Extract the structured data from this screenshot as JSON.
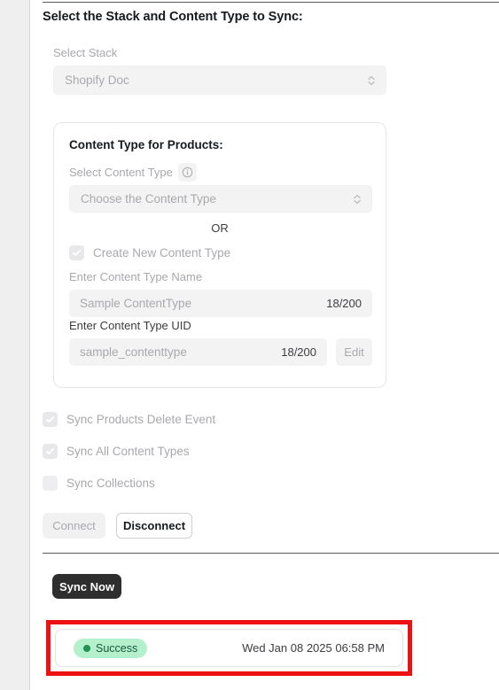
{
  "section": {
    "title": "Select the Stack and Content Type to Sync:"
  },
  "stack": {
    "label": "Select Stack",
    "value": "Shopify Doc",
    "stepper_icon": "up-down-chevron-icon"
  },
  "content_type_card": {
    "title": "Content Type for Products:",
    "select_label": "Select Content Type",
    "info_icon": "info-icon",
    "select_value": "Choose the Content Type",
    "select_stepper_icon": "up-down-chevron-icon",
    "or_text": "OR",
    "create_new": {
      "label": "Create New Content Type",
      "checked": true
    },
    "name_field": {
      "label": "Enter Content Type Name",
      "value": "Sample ContentType",
      "counter": "18/200"
    },
    "uid_field": {
      "label": "Enter Content Type UID",
      "value": "sample_contenttype",
      "counter": "18/200",
      "edit_label": "Edit"
    }
  },
  "options": [
    {
      "label": "Sync Products Delete Event",
      "checked": true
    },
    {
      "label": "Sync All Content Types",
      "checked": true
    },
    {
      "label": "Sync Collections",
      "checked": false
    }
  ],
  "actions": {
    "connect_label": "Connect",
    "disconnect_label": "Disconnect",
    "sync_now_label": "Sync Now"
  },
  "status": {
    "badge_label": "Success",
    "timestamp": "Wed Jan 08 2025 06:58 PM",
    "badge_bg": "#b5f0cd",
    "badge_fg": "#18593a",
    "dot_color": "#1f9254",
    "highlight_color": "#ee1111"
  }
}
